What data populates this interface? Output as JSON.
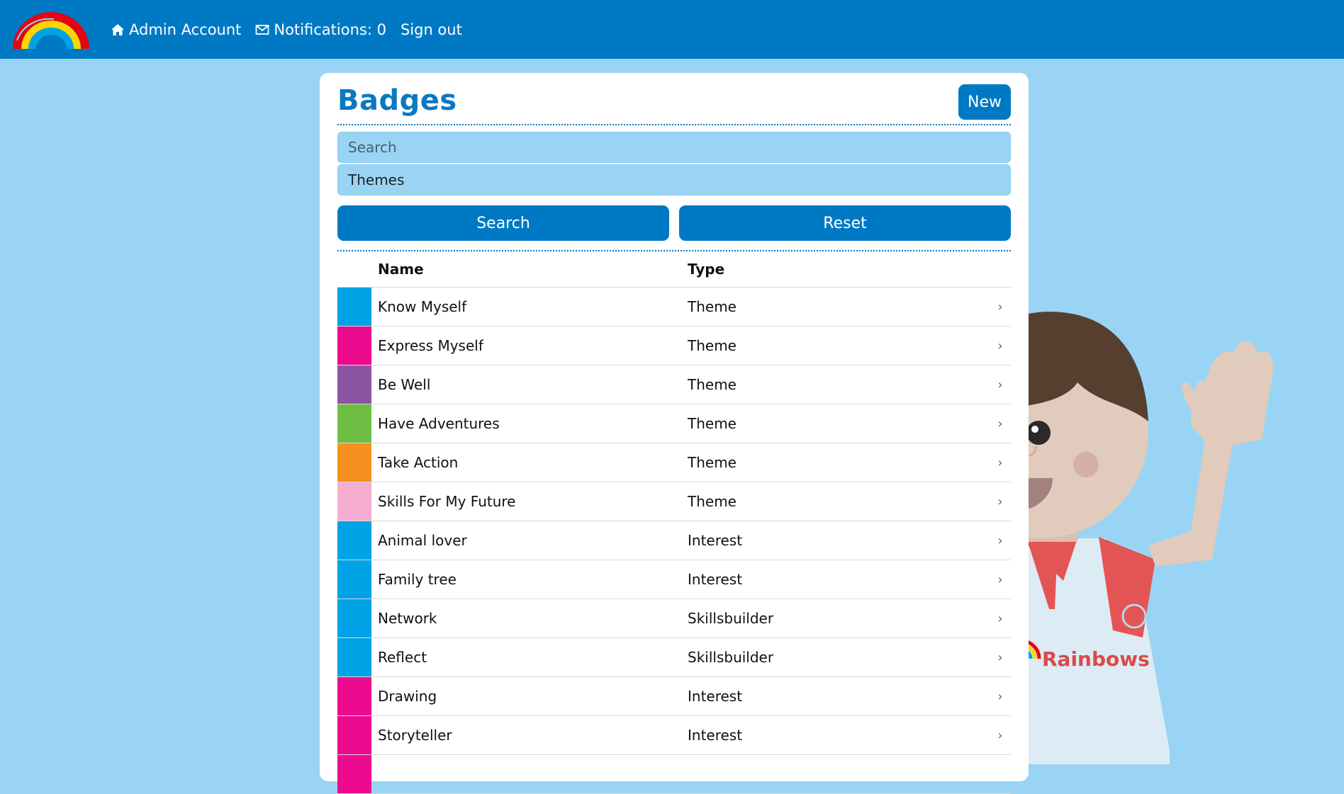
{
  "nav": {
    "account_label": "Admin Account",
    "notifications_label": "Notifications: 0",
    "signout_label": "Sign out"
  },
  "page": {
    "title": "Badges",
    "new_label": "New"
  },
  "filters": {
    "search_placeholder": "Search",
    "themes_value": "Themes",
    "search_button": "Search",
    "reset_button": "Reset"
  },
  "table": {
    "headers": {
      "name": "Name",
      "type": "Type"
    },
    "rows": [
      {
        "name": "Know Myself",
        "type": "Theme",
        "color": "#00a3e6"
      },
      {
        "name": "Express Myself",
        "type": "Theme",
        "color": "#ec0b8e"
      },
      {
        "name": "Be Well",
        "type": "Theme",
        "color": "#8c55a2"
      },
      {
        "name": "Have Adventures",
        "type": "Theme",
        "color": "#6ebe44"
      },
      {
        "name": "Take Action",
        "type": "Theme",
        "color": "#f6901e"
      },
      {
        "name": "Skills For My Future",
        "type": "Theme",
        "color": "#f5add0"
      },
      {
        "name": "Animal lover",
        "type": "Interest",
        "color": "#00a3e6"
      },
      {
        "name": "Family tree",
        "type": "Interest",
        "color": "#00a3e6"
      },
      {
        "name": "Network",
        "type": "Skillsbuilder",
        "color": "#00a3e6"
      },
      {
        "name": "Reflect",
        "type": "Skillsbuilder",
        "color": "#00a3e6"
      },
      {
        "name": "Drawing",
        "type": "Interest",
        "color": "#ec0b8e"
      },
      {
        "name": "Storyteller",
        "type": "Interest",
        "color": "#ec0b8e"
      },
      {
        "name": "",
        "type": "",
        "color": "#ec0b8e"
      }
    ]
  },
  "mascot": {
    "shirt_text": "Rainbows"
  }
}
